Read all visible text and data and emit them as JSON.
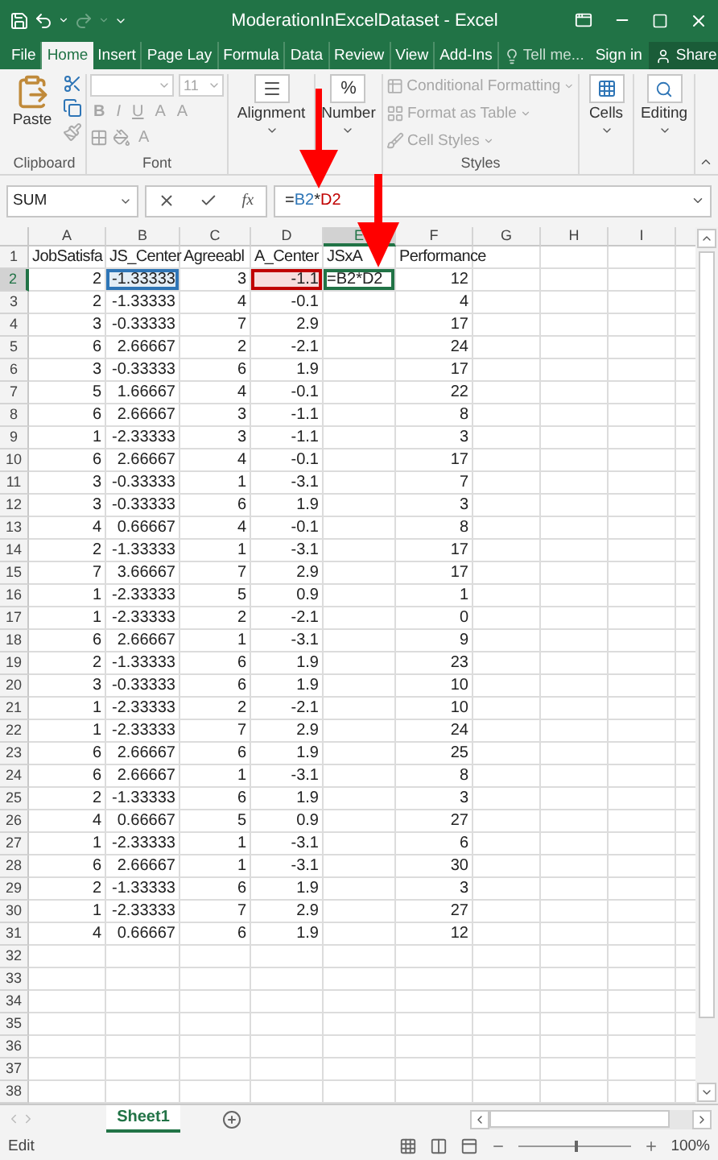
{
  "window": {
    "title": "ModerationInExcelDataset - Excel"
  },
  "ribbon_tabs": [
    {
      "label": "File",
      "selected": false
    },
    {
      "label": "Home",
      "selected": true
    },
    {
      "label": "Insert",
      "selected": false
    },
    {
      "label": "Page Lay",
      "selected": false
    },
    {
      "label": "Formula",
      "selected": false
    },
    {
      "label": "Data",
      "selected": false
    },
    {
      "label": "Review",
      "selected": false
    },
    {
      "label": "View",
      "selected": false
    },
    {
      "label": "Add-Ins",
      "selected": false
    }
  ],
  "tell_me": "Tell me...",
  "sign_in": "Sign in",
  "share": "Share",
  "ribbon": {
    "clipboard": {
      "label": "Clipboard",
      "paste": "Paste"
    },
    "font": {
      "label": "Font",
      "disabled": true,
      "size": "11",
      "bold": "B",
      "italic": "I",
      "underline": "U",
      "grow": "A",
      "shrink": "A",
      "font_color": "A"
    },
    "alignment": {
      "label": "Alignment"
    },
    "number": {
      "label": "Number",
      "symbol": "%"
    },
    "styles": {
      "label": "Styles",
      "items": [
        {
          "label": "Conditional Formatting",
          "disabled": true
        },
        {
          "label": "Format as Table",
          "disabled": true
        },
        {
          "label": "Cell Styles",
          "disabled": true
        }
      ]
    },
    "cells": {
      "label": "Cells"
    },
    "editing": {
      "label": "Editing"
    }
  },
  "formula_bar": {
    "name_box": "SUM",
    "fx": "fx",
    "formula": [
      {
        "text": "="
      },
      {
        "text": "B2",
        "color": "#2e75b6"
      },
      {
        "text": "*"
      },
      {
        "text": "D2",
        "color": "#c00000"
      }
    ]
  },
  "columns": [
    {
      "label": "A",
      "selected": false
    },
    {
      "label": "B",
      "selected": false
    },
    {
      "label": "C",
      "selected": false
    },
    {
      "label": "D",
      "selected": false
    },
    {
      "label": "E",
      "selected": true
    },
    {
      "label": "F",
      "selected": false
    },
    {
      "label": "G",
      "selected": false
    },
    {
      "label": "H",
      "selected": false
    },
    {
      "label": "I",
      "selected": false
    }
  ],
  "rows": [
    {
      "number": "1",
      "selected": false,
      "kind": "header",
      "cells": [
        "JobSatisfa",
        "JS_Center",
        "Agreeabl",
        "A_Center",
        "JSxA",
        "Performance"
      ]
    },
    {
      "number": "2",
      "selected": true,
      "kind": "data",
      "cells": [
        {
          "text": "2"
        },
        {
          "text": "-1.33333",
          "color": "#2e75b6"
        },
        {
          "text": "3"
        },
        {
          "text": "-1.1",
          "color": "#c00000"
        },
        {
          "text": "=B2*D2",
          "editing": true
        },
        {
          "text": "12"
        }
      ]
    },
    {
      "number": "3",
      "selected": false,
      "kind": "data",
      "cells": [
        "2",
        "-1.33333",
        "4",
        "-0.1",
        null,
        "4"
      ]
    },
    {
      "number": "4",
      "selected": false,
      "kind": "data",
      "cells": [
        "3",
        "-0.33333",
        "7",
        "2.9",
        null,
        "17"
      ]
    },
    {
      "number": "5",
      "selected": false,
      "kind": "data",
      "cells": [
        "6",
        "2.66667",
        "2",
        "-2.1",
        null,
        "24"
      ]
    },
    {
      "number": "6",
      "selected": false,
      "kind": "data",
      "cells": [
        "3",
        "-0.33333",
        "6",
        "1.9",
        null,
        "17"
      ]
    },
    {
      "number": "7",
      "selected": false,
      "kind": "data",
      "cells": [
        "5",
        "1.66667",
        "4",
        "-0.1",
        null,
        "22"
      ]
    },
    {
      "number": "8",
      "selected": false,
      "kind": "data",
      "cells": [
        "6",
        "2.66667",
        "3",
        "-1.1",
        null,
        "8"
      ]
    },
    {
      "number": "9",
      "selected": false,
      "kind": "data",
      "cells": [
        "1",
        "-2.33333",
        "3",
        "-1.1",
        null,
        "3"
      ]
    },
    {
      "number": "10",
      "selected": false,
      "kind": "data",
      "cells": [
        "6",
        "2.66667",
        "4",
        "-0.1",
        null,
        "17"
      ]
    },
    {
      "number": "11",
      "selected": false,
      "kind": "data",
      "cells": [
        "3",
        "-0.33333",
        "1",
        "-3.1",
        null,
        "7"
      ]
    },
    {
      "number": "12",
      "selected": false,
      "kind": "data",
      "cells": [
        "3",
        "-0.33333",
        "6",
        "1.9",
        null,
        "3"
      ]
    },
    {
      "number": "13",
      "selected": false,
      "kind": "data",
      "cells": [
        "4",
        "0.66667",
        "4",
        "-0.1",
        null,
        "8"
      ]
    },
    {
      "number": "14",
      "selected": false,
      "kind": "data",
      "cells": [
        "2",
        "-1.33333",
        "1",
        "-3.1",
        null,
        "17"
      ]
    },
    {
      "number": "15",
      "selected": false,
      "kind": "data",
      "cells": [
        "7",
        "3.66667",
        "7",
        "2.9",
        null,
        "17"
      ]
    },
    {
      "number": "16",
      "selected": false,
      "kind": "data",
      "cells": [
        "1",
        "-2.33333",
        "5",
        "0.9",
        null,
        "1"
      ]
    },
    {
      "number": "17",
      "selected": false,
      "kind": "data",
      "cells": [
        "1",
        "-2.33333",
        "2",
        "-2.1",
        null,
        "0"
      ]
    },
    {
      "number": "18",
      "selected": false,
      "kind": "data",
      "cells": [
        "6",
        "2.66667",
        "1",
        "-3.1",
        null,
        "9"
      ]
    },
    {
      "number": "19",
      "selected": false,
      "kind": "data",
      "cells": [
        "2",
        "-1.33333",
        "6",
        "1.9",
        null,
        "23"
      ]
    },
    {
      "number": "20",
      "selected": false,
      "kind": "data",
      "cells": [
        "3",
        "-0.33333",
        "6",
        "1.9",
        null,
        "10"
      ]
    },
    {
      "number": "21",
      "selected": false,
      "kind": "data",
      "cells": [
        "1",
        "-2.33333",
        "2",
        "-2.1",
        null,
        "10"
      ]
    },
    {
      "number": "22",
      "selected": false,
      "kind": "data",
      "cells": [
        "1",
        "-2.33333",
        "7",
        "2.9",
        null,
        "24"
      ]
    },
    {
      "number": "23",
      "selected": false,
      "kind": "data",
      "cells": [
        "6",
        "2.66667",
        "6",
        "1.9",
        null,
        "25"
      ]
    },
    {
      "number": "24",
      "selected": false,
      "kind": "data",
      "cells": [
        "6",
        "2.66667",
        "1",
        "-3.1",
        null,
        "8"
      ]
    },
    {
      "number": "25",
      "selected": false,
      "kind": "data",
      "cells": [
        "2",
        "-1.33333",
        "6",
        "1.9",
        null,
        "3"
      ]
    },
    {
      "number": "26",
      "selected": false,
      "kind": "data",
      "cells": [
        "4",
        "0.66667",
        "5",
        "0.9",
        null,
        "27"
      ]
    },
    {
      "number": "27",
      "selected": false,
      "kind": "data",
      "cells": [
        "1",
        "-2.33333",
        "1",
        "-3.1",
        null,
        "6"
      ]
    },
    {
      "number": "28",
      "selected": false,
      "kind": "data",
      "cells": [
        "6",
        "2.66667",
        "1",
        "-3.1",
        null,
        "30"
      ]
    },
    {
      "number": "29",
      "selected": false,
      "kind": "data",
      "cells": [
        "2",
        "-1.33333",
        "6",
        "1.9",
        null,
        "3"
      ]
    },
    {
      "number": "30",
      "selected": false,
      "kind": "data",
      "cells": [
        "1",
        "-2.33333",
        "7",
        "2.9",
        null,
        "27"
      ]
    },
    {
      "number": "31",
      "selected": false,
      "kind": "data",
      "cells": [
        "4",
        "0.66667",
        "6",
        "1.9",
        null,
        "12"
      ]
    },
    {
      "number": "32",
      "selected": false,
      "kind": "data"
    },
    {
      "number": "33",
      "selected": false,
      "kind": "data"
    },
    {
      "number": "34",
      "selected": false,
      "kind": "data"
    },
    {
      "number": "35",
      "selected": false,
      "kind": "data"
    },
    {
      "number": "36",
      "selected": false,
      "kind": "data"
    },
    {
      "number": "37",
      "selected": false,
      "kind": "data"
    },
    {
      "number": "38",
      "selected": false,
      "kind": "data"
    }
  ],
  "sheets": [
    {
      "name": "Sheet1",
      "selected": true
    }
  ],
  "status_bar": {
    "mode": "Edit",
    "zoom": "100%",
    "zoom_slider": {
      "level": 0.5
    }
  }
}
